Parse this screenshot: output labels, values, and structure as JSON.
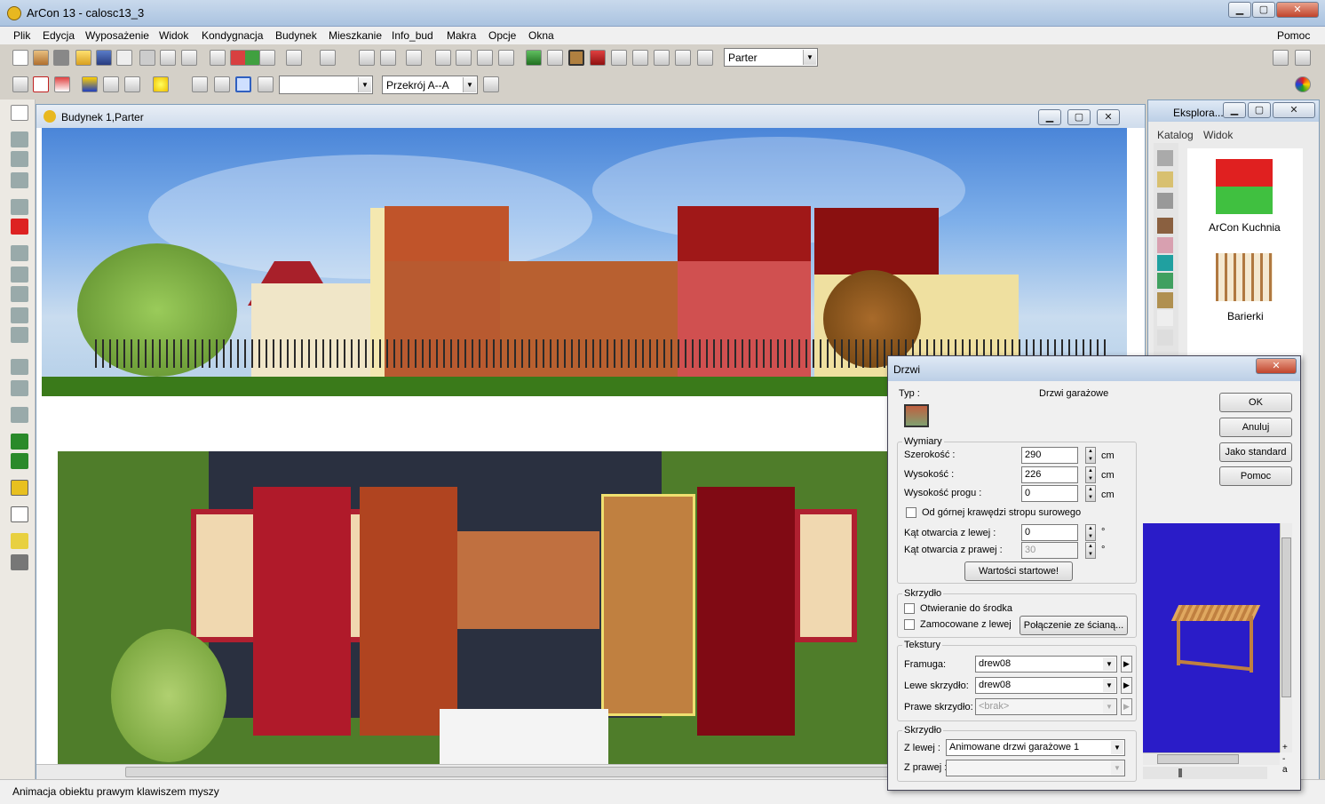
{
  "app": {
    "title": "ArCon 13 - calosc13_3"
  },
  "window_controls": {
    "minimize": "▁",
    "maximize": "▢",
    "close": "✕"
  },
  "menu": {
    "items": [
      "Plik",
      "Edycja",
      "Wyposażenie",
      "Widok",
      "Kondygnacja",
      "Budynek",
      "Mieszkanie",
      "Info_bud",
      "Makra",
      "Opcje",
      "Okna"
    ],
    "help": "Pomoc"
  },
  "toolbar1": {
    "floor_select": "Parter"
  },
  "toolbar2": {
    "section_select": "Przekrój A--A",
    "empty_select": ""
  },
  "document": {
    "title": "Budynek 1,Parter"
  },
  "explorer": {
    "title": "Eksplora...",
    "tabs": [
      "Katalog",
      "Widok"
    ],
    "items": [
      "ArCon Kuchnia",
      "Barierki"
    ]
  },
  "status": {
    "text": "Animacja obiektu prawym klawiszem myszy"
  },
  "dialog": {
    "title": "Drzwi",
    "close": "✕",
    "type_label": "Typ :",
    "type_value": "Drzwi garażowe",
    "dimensions": {
      "label": "Wymiary",
      "width_label": "Szerokość :",
      "width": "290",
      "width_unit": "cm",
      "height_label": "Wysokość :",
      "height": "226",
      "height_unit": "cm",
      "sill_label": "Wysokość progu :",
      "sill": "0",
      "sill_unit": "cm",
      "top_edge_label": "Od górnej krawędzi stropu surowego",
      "angle_left_label": "Kąt otwarcia z lewej :",
      "angle_left": "0",
      "angle_left_unit": "°",
      "angle_right_label": "Kąt otwarcia z prawej :",
      "angle_right": "30",
      "angle_right_unit": "°",
      "start_values_button": "Wartości startowe!"
    },
    "sash": {
      "label": "Skrzydło",
      "open_inside": "Otwieranie do środka",
      "hinged_left": "Zamocowane z lewej",
      "wall_connection_button": "Połączenie ze ścianą..."
    },
    "textures": {
      "label": "Tekstury",
      "frame_label": "Framuga:",
      "frame": "drew08",
      "left_sash_label": "Lewe skrzydło:",
      "left_sash": "drew08",
      "right_sash_label": "Prawe skrzydło:",
      "right_sash": "<brak>"
    },
    "sash2": {
      "label": "Skrzydło",
      "left_label": "Z lewej :",
      "left": "Animowane drzwi garażowe 1",
      "right_label": "Z prawej :",
      "right": ""
    },
    "buttons": {
      "ok": "OK",
      "cancel": "Anuluj",
      "default": "Jako standard",
      "help": "Pomoc"
    },
    "preview_labels": {
      "plus": "+",
      "minus": "-",
      "a": "a"
    }
  }
}
